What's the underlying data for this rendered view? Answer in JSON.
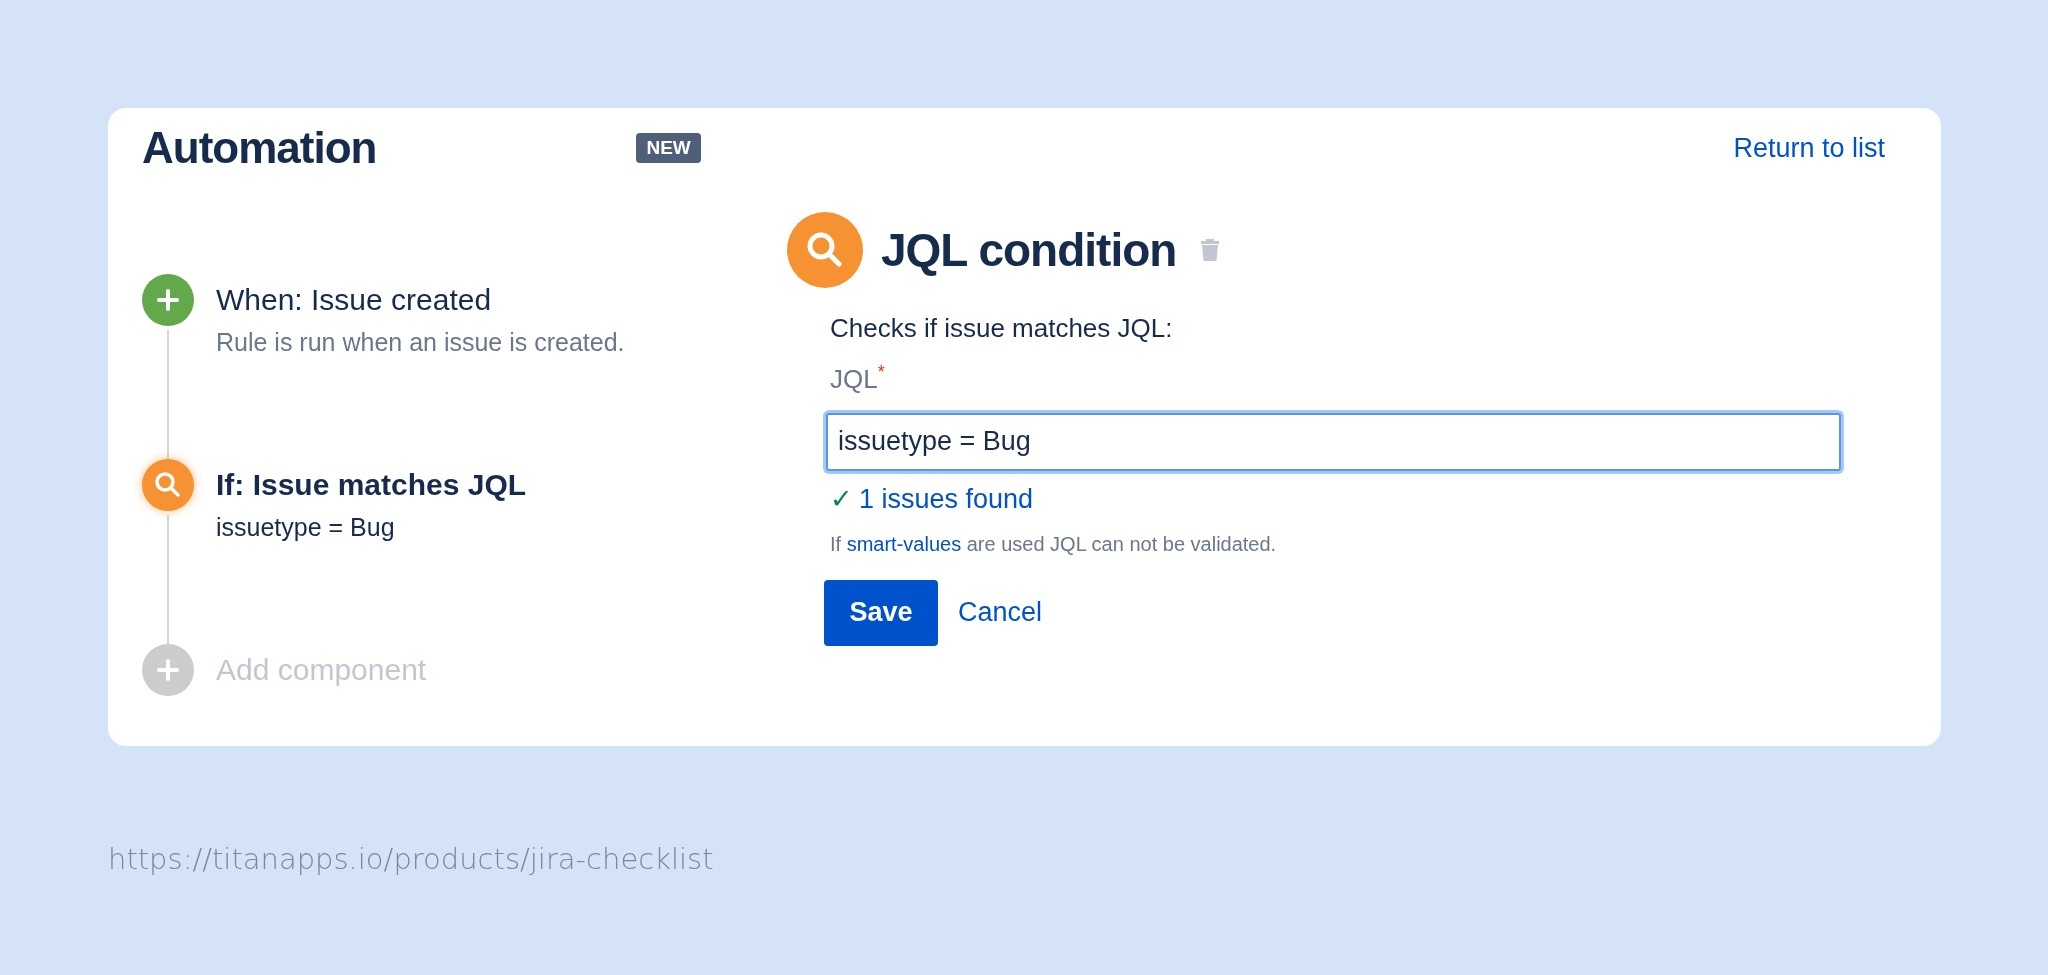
{
  "header": {
    "title": "Automation",
    "badge": "NEW",
    "return_link": "Return to list"
  },
  "steps": [
    {
      "kind": "trigger",
      "title": "When: Issue created",
      "description": "Rule is run when an issue is created.",
      "selected": false,
      "disabled": false
    },
    {
      "kind": "condition",
      "title": "If: Issue matches JQL",
      "description": "issuetype = Bug",
      "selected": true,
      "disabled": false
    },
    {
      "kind": "add",
      "title": "Add component",
      "selected": false,
      "disabled": true
    }
  ],
  "panel": {
    "title": "JQL condition",
    "intro": "Checks if issue matches JQL:",
    "field_label": "JQL",
    "required_mark": "*",
    "field_value": "issuetype = Bug",
    "focused": true,
    "check_mark": "✓",
    "result": "1 issues found",
    "hint_before": "If ",
    "hint_link": "smart-values",
    "hint_after": " are used JQL can not be validated.",
    "buttons": [
      "Save",
      "Cancel"
    ]
  },
  "caption": "https://titanapps.io/products/jira-checklist"
}
